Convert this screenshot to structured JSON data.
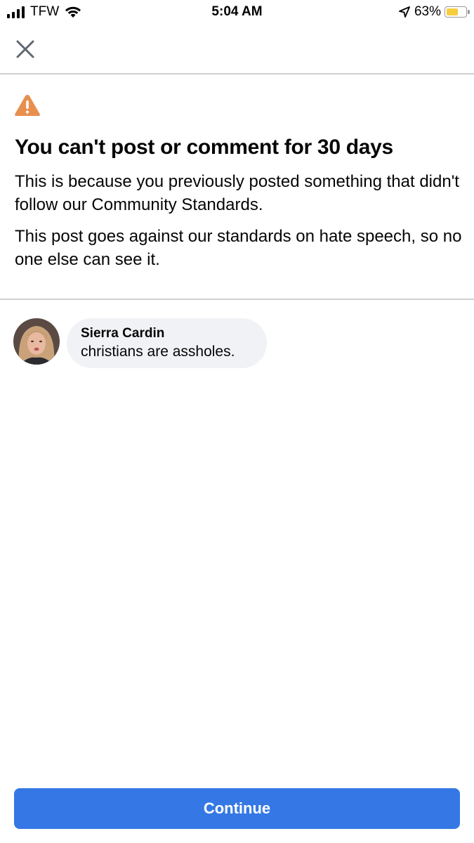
{
  "status_bar": {
    "carrier": "TFW",
    "time": "5:04 AM",
    "battery_percent_label": "63%",
    "battery_level": 0.63,
    "battery_color": "#f7cd3f",
    "signal_bars": 4,
    "icons": [
      "cellular-signal-icon",
      "wifi-icon",
      "location-arrow-icon",
      "battery-icon"
    ]
  },
  "header": {
    "close_icon": "close-icon"
  },
  "notice": {
    "icon": "warning-triangle-icon",
    "icon_color": "#e88f4e",
    "title": "You can't post or comment for 30 days",
    "paragraph_1": "This is because you previously posted something that didn't follow our Community Standards.",
    "paragraph_2": "This post goes against our standards on hate speech, so no one else can see it."
  },
  "comment": {
    "author": "Sierra Cardin",
    "text": "christians are assholes.",
    "avatar": "profile-photo"
  },
  "footer": {
    "continue_label": "Continue",
    "accent_color": "#3578e5"
  }
}
